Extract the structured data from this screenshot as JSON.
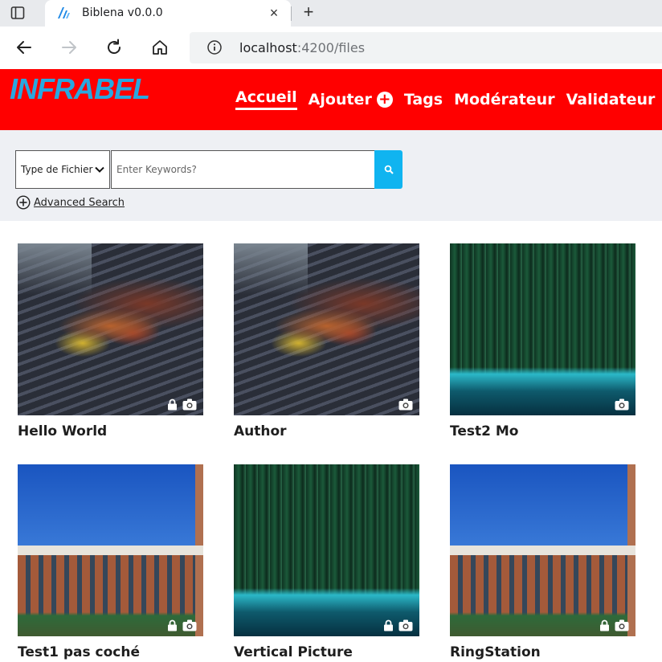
{
  "browser": {
    "tab_title": "Biblena v0.0.0",
    "close_glyph": "×",
    "newtab_glyph": "+",
    "url_host": "localhost",
    "url_rest": ":4200/files"
  },
  "header": {
    "logo": "INFRABEL",
    "nav": [
      {
        "label": "Accueil"
      },
      {
        "label": "Ajouter"
      },
      {
        "label": "Tags"
      },
      {
        "label": "Modérateur"
      },
      {
        "label": "Validateur"
      }
    ],
    "color": "#ff0000"
  },
  "search": {
    "type_label": "Type de Fichier",
    "keywords_placeholder": "Enter Keywords?",
    "advanced_label": "Advanced Search",
    "button_color": "#10b4f0"
  },
  "files": [
    {
      "title": "Hello World",
      "image": "bbq-icon",
      "locked": true
    },
    {
      "title": "Author",
      "image": "bbq-icon",
      "locked": false
    },
    {
      "title": "Test2 Mo",
      "image": "forest-icon",
      "locked": false
    },
    {
      "title": "Test1 pas coché",
      "image": "building-icon",
      "locked": true
    },
    {
      "title": "Vertical Picture",
      "image": "forest-icon",
      "locked": true
    },
    {
      "title": "RingStation",
      "image": "building-icon",
      "locked": true
    }
  ]
}
